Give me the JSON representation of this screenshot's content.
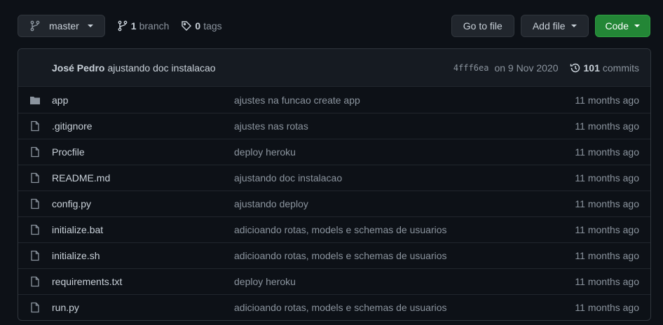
{
  "toolbar": {
    "branch_selector": "master",
    "branch_count": "1",
    "branch_label": "branch",
    "tag_count": "0",
    "tag_label": "tags",
    "go_to_file": "Go to file",
    "add_file": "Add file",
    "code": "Code"
  },
  "latest_commit": {
    "author": "José Pedro",
    "message": "ajustando doc instalacao",
    "sha": "4fff6ea",
    "date": "on 9 Nov 2020",
    "commit_count": "101",
    "commit_label": "commits"
  },
  "files": [
    {
      "type": "folder",
      "name": "app",
      "message": "ajustes na funcao create app",
      "age": "11 months ago"
    },
    {
      "type": "file",
      "name": ".gitignore",
      "message": "ajustes nas rotas",
      "age": "11 months ago"
    },
    {
      "type": "file",
      "name": "Procfile",
      "message": "deploy heroku",
      "age": "11 months ago"
    },
    {
      "type": "file",
      "name": "README.md",
      "message": "ajustando doc instalacao",
      "age": "11 months ago"
    },
    {
      "type": "file",
      "name": "config.py",
      "message": "ajustando deploy",
      "age": "11 months ago"
    },
    {
      "type": "file",
      "name": "initialize.bat",
      "message": "adicioando rotas, models e schemas de usuarios",
      "age": "11 months ago"
    },
    {
      "type": "file",
      "name": "initialize.sh",
      "message": "adicioando rotas, models e schemas de usuarios",
      "age": "11 months ago"
    },
    {
      "type": "file",
      "name": "requirements.txt",
      "message": "deploy heroku",
      "age": "11 months ago"
    },
    {
      "type": "file",
      "name": "run.py",
      "message": "adicioando rotas, models e schemas de usuarios",
      "age": "11 months ago"
    }
  ]
}
